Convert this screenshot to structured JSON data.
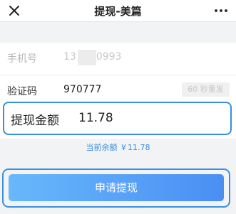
{
  "nav": {
    "title": "提现-美篇",
    "close_icon": "close-icon",
    "more_icon": "more-dots-icon"
  },
  "form": {
    "phone": {
      "label": "手机号",
      "value_prefix": "13",
      "value_suffix": "0993"
    },
    "code": {
      "label": "验证码",
      "value": "970777",
      "resend_label": "60 秒重发"
    }
  },
  "amount": {
    "label": "提现金额",
    "value": "11.78"
  },
  "balance": {
    "prefix": "当前余额",
    "currency": "¥",
    "value": "11.78"
  },
  "submit": {
    "label": "申请提现"
  },
  "colors": {
    "accent": "#3a8fe0",
    "button_start": "#68b8fb",
    "button_end": "#4a8ef4"
  }
}
